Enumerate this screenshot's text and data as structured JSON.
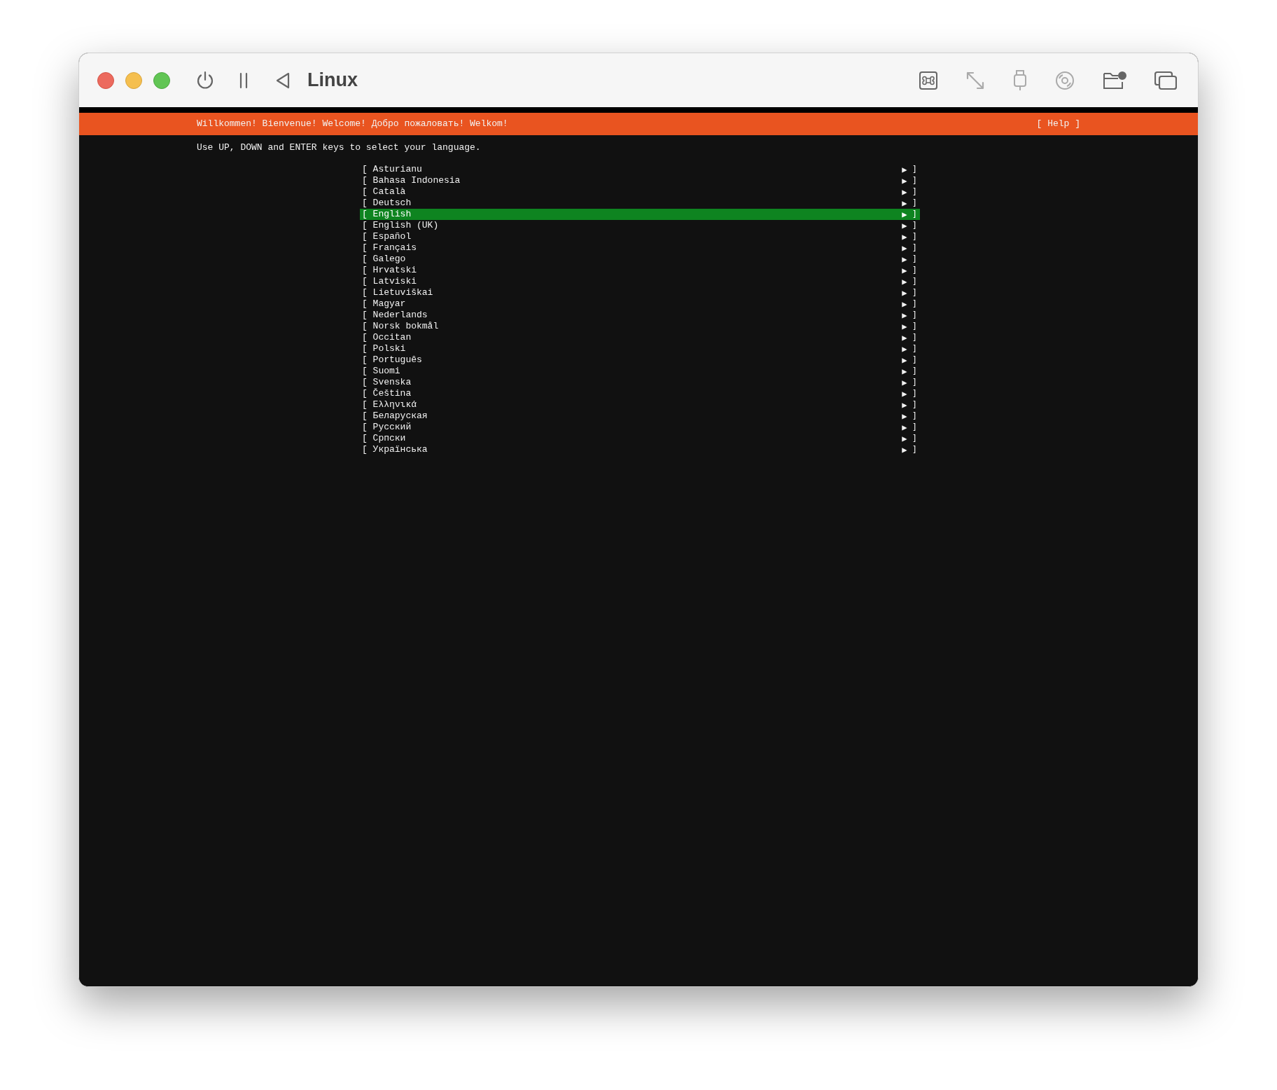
{
  "window": {
    "title": "Linux"
  },
  "banner": {
    "title": "Willkommen! Bienvenue! Welcome! Добро пожаловать! Welkom!",
    "help": "[ Help ]"
  },
  "instruction": "Use UP, DOWN and ENTER keys to select your language.",
  "languages": [
    {
      "open": "[",
      "label": "Asturianu",
      "arrow": "▶",
      "close": "]",
      "selected": false
    },
    {
      "open": "[",
      "label": "Bahasa Indonesia",
      "arrow": "▶",
      "close": "]",
      "selected": false
    },
    {
      "open": "[",
      "label": "Català",
      "arrow": "▶",
      "close": "]",
      "selected": false
    },
    {
      "open": "[",
      "label": "Deutsch",
      "arrow": "▶",
      "close": "]",
      "selected": false
    },
    {
      "open": "[",
      "label": "English",
      "arrow": "▶",
      "close": "]",
      "selected": true
    },
    {
      "open": "[",
      "label": "English (UK)",
      "arrow": "▶",
      "close": "]",
      "selected": false
    },
    {
      "open": "[",
      "label": "Español",
      "arrow": "▶",
      "close": "]",
      "selected": false
    },
    {
      "open": "[",
      "label": "Français",
      "arrow": "▶",
      "close": "]",
      "selected": false
    },
    {
      "open": "[",
      "label": "Galego",
      "arrow": "▶",
      "close": "]",
      "selected": false
    },
    {
      "open": "[",
      "label": "Hrvatski",
      "arrow": "▶",
      "close": "]",
      "selected": false
    },
    {
      "open": "[",
      "label": "Latviski",
      "arrow": "▶",
      "close": "]",
      "selected": false
    },
    {
      "open": "[",
      "label": "Lietuviškai",
      "arrow": "▶",
      "close": "]",
      "selected": false
    },
    {
      "open": "[",
      "label": "Magyar",
      "arrow": "▶",
      "close": "]",
      "selected": false
    },
    {
      "open": "[",
      "label": "Nederlands",
      "arrow": "▶",
      "close": "]",
      "selected": false
    },
    {
      "open": "[",
      "label": "Norsk bokmål",
      "arrow": "▶",
      "close": "]",
      "selected": false
    },
    {
      "open": "[",
      "label": "Occitan",
      "arrow": "▶",
      "close": "]",
      "selected": false
    },
    {
      "open": "[",
      "label": "Polski",
      "arrow": "▶",
      "close": "]",
      "selected": false
    },
    {
      "open": "[",
      "label": "Português",
      "arrow": "▶",
      "close": "]",
      "selected": false
    },
    {
      "open": "[",
      "label": "Suomi",
      "arrow": "▶",
      "close": "]",
      "selected": false
    },
    {
      "open": "[",
      "label": "Svenska",
      "arrow": "▶",
      "close": "]",
      "selected": false
    },
    {
      "open": "[",
      "label": "Čeština",
      "arrow": "▶",
      "close": "]",
      "selected": false
    },
    {
      "open": "[",
      "label": "Ελληνικά",
      "arrow": "▶",
      "close": "]",
      "selected": false
    },
    {
      "open": "[",
      "label": "Беларуская",
      "arrow": "▶",
      "close": "]",
      "selected": false
    },
    {
      "open": "[",
      "label": "Русский",
      "arrow": "▶",
      "close": "]",
      "selected": false
    },
    {
      "open": "[",
      "label": "Српски",
      "arrow": "▶",
      "close": "]",
      "selected": false
    },
    {
      "open": "[",
      "label": "Українська",
      "arrow": "▶",
      "close": "]",
      "selected": false
    }
  ]
}
